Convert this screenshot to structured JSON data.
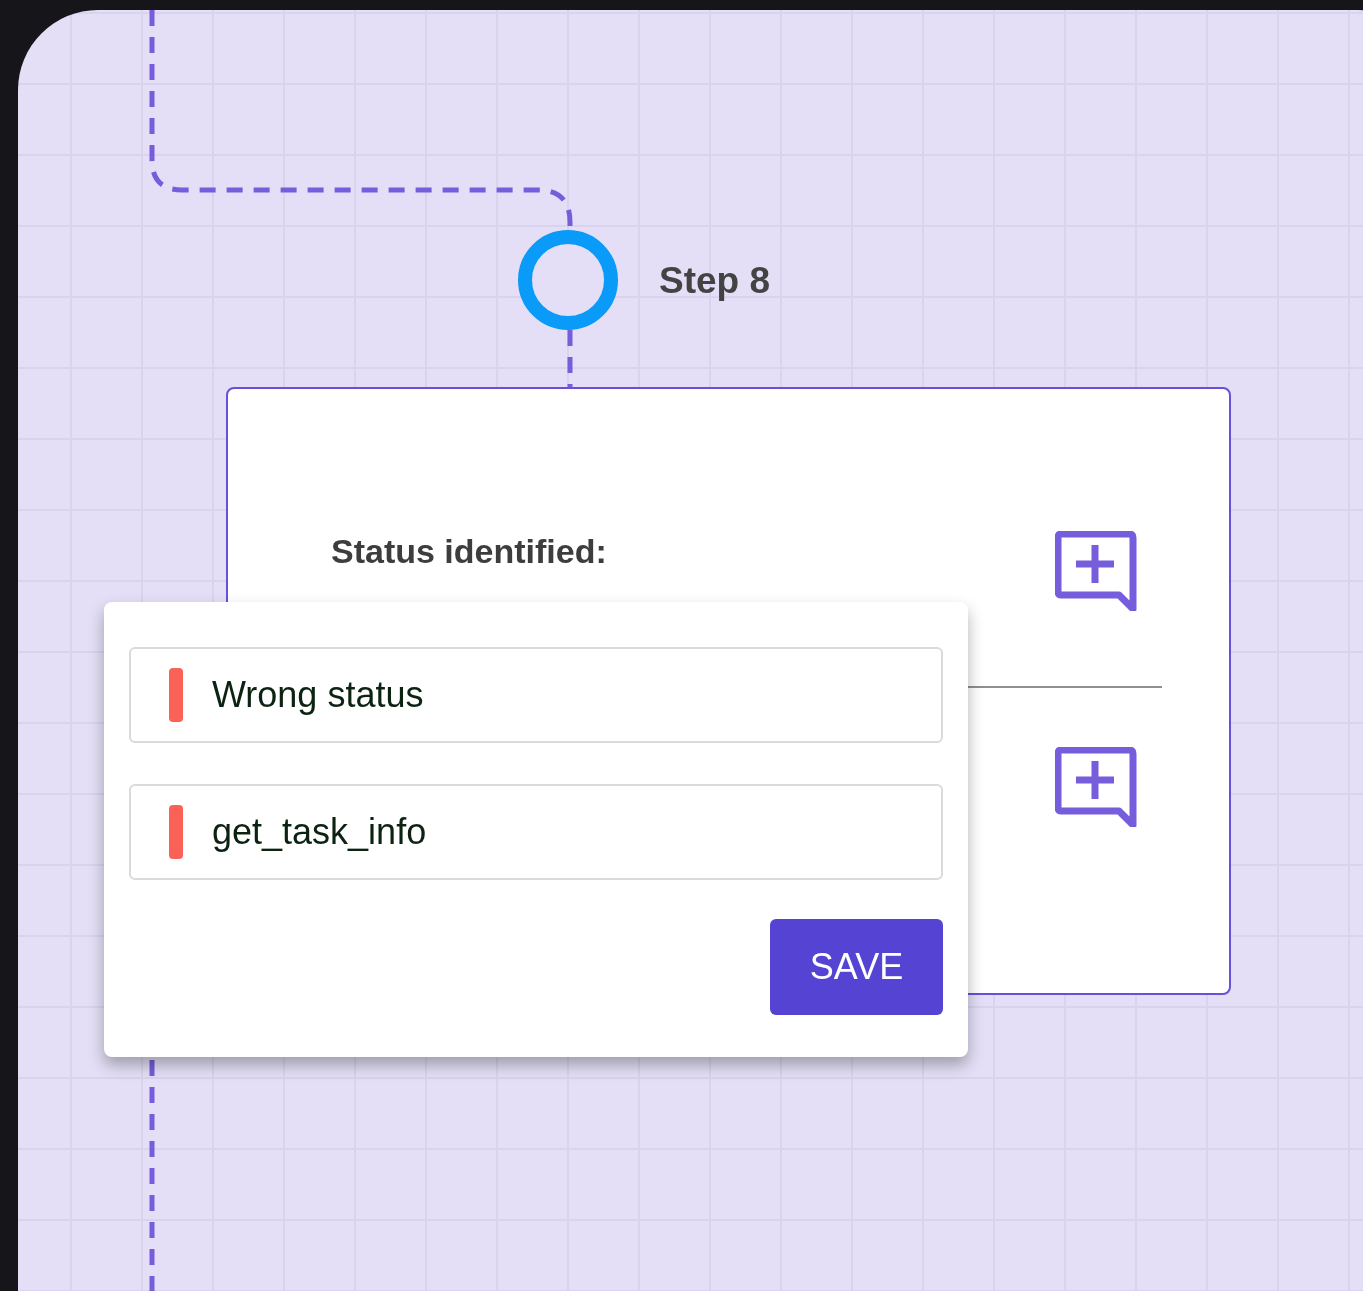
{
  "step": {
    "label": "Step 8"
  },
  "card": {
    "heading": "Status identified:"
  },
  "popup": {
    "fields": [
      {
        "value": "Wrong status"
      },
      {
        "value": "get_task_info"
      }
    ],
    "save_button": "SAVE"
  }
}
